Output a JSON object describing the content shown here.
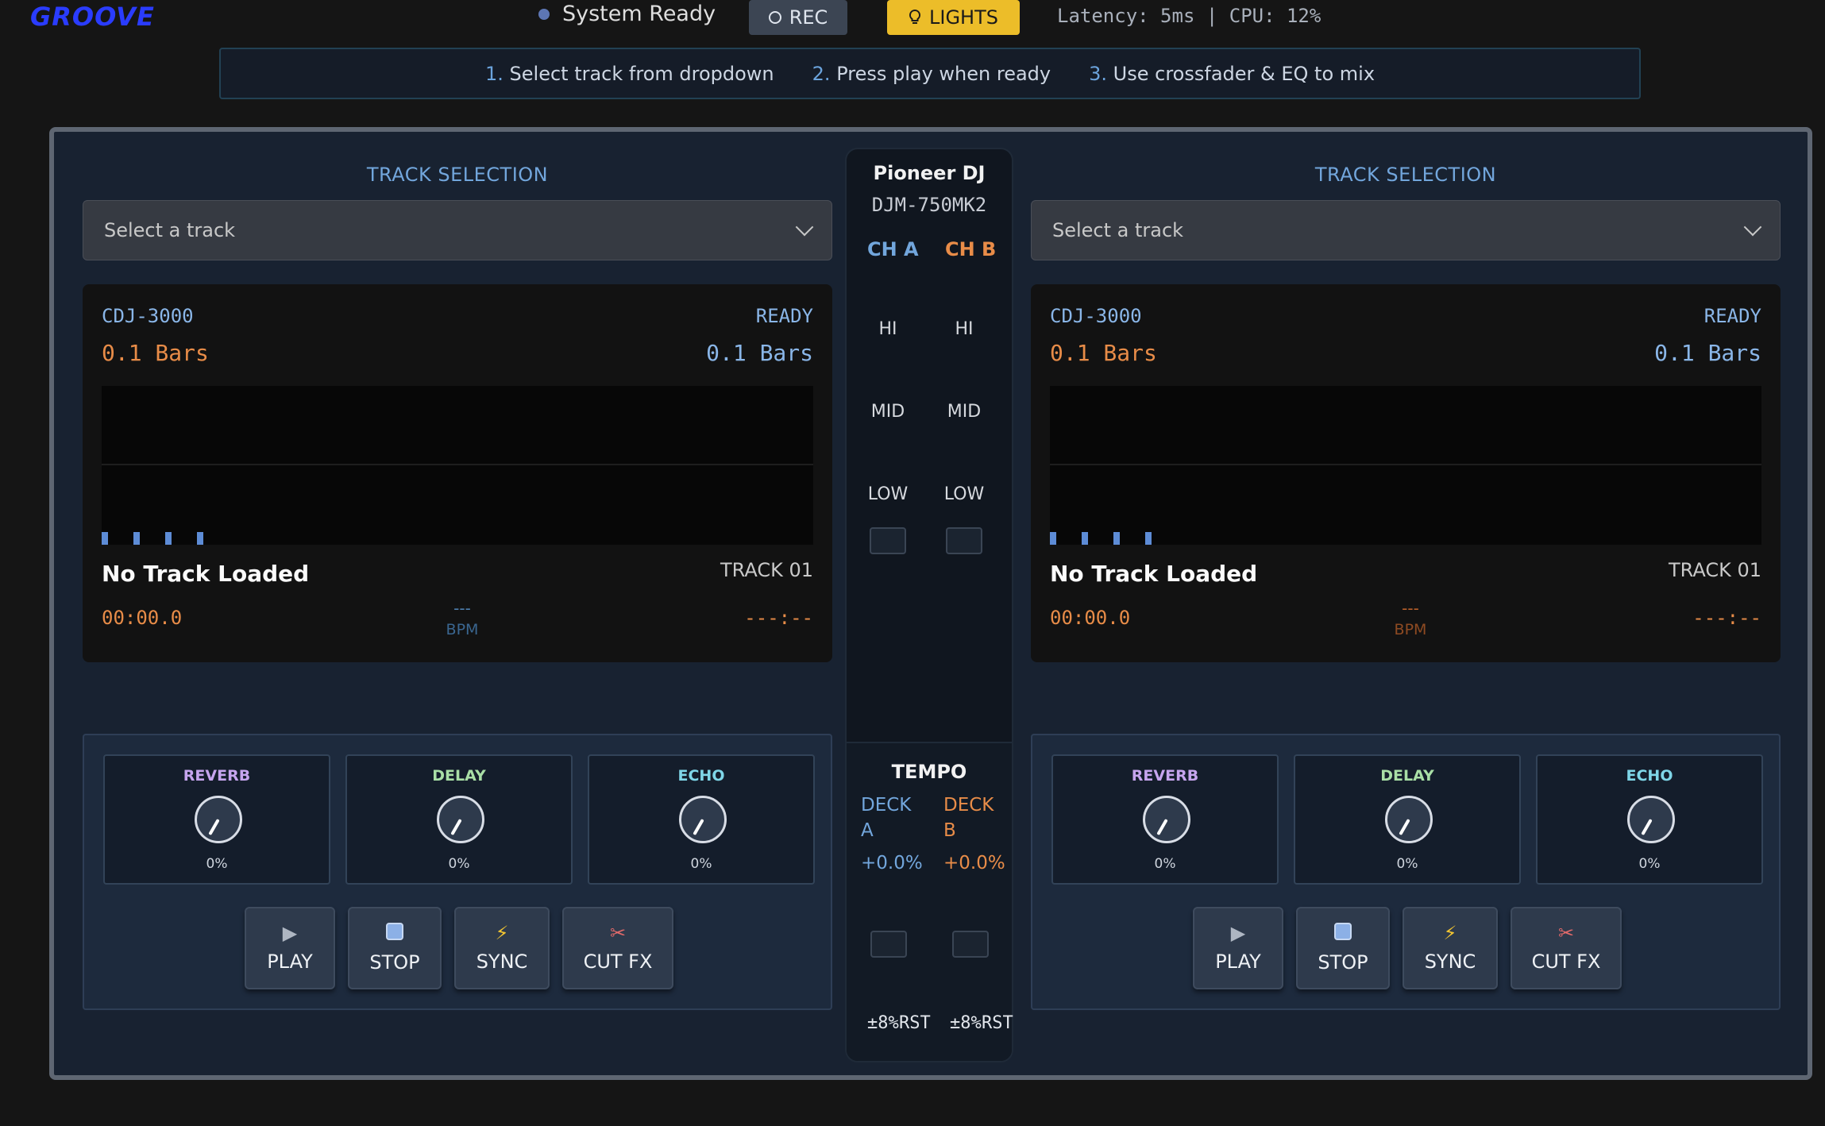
{
  "app": {
    "logo": "GROOVE",
    "status": "System Ready",
    "rec_label": "REC",
    "lights_label": "LIGHTS",
    "latency": "Latency: 5ms | CPU: 12%"
  },
  "instructions": [
    {
      "num": "1.",
      "text": "Select track from dropdown"
    },
    {
      "num": "2.",
      "text": "Press play when ready"
    },
    {
      "num": "3.",
      "text": "Use crossfader & EQ to mix"
    }
  ],
  "decks": [
    {
      "section_label": "TRACK SELECTION",
      "select_placeholder": "Select a track",
      "player_model": "CDJ-3000",
      "player_status": "READY",
      "bars_left": "0.1 Bars",
      "bars_right": "0.1 Bars",
      "track_title": "No Track Loaded",
      "track_number": "TRACK 01",
      "elapsed": "00:00.0",
      "bpm_value": "---",
      "bpm_label": "BPM",
      "remaining": "---:--",
      "fx": [
        {
          "label": "REVERB",
          "value": "0%"
        },
        {
          "label": "DELAY",
          "value": "0%"
        },
        {
          "label": "ECHO",
          "value": "0%"
        }
      ],
      "transport": [
        {
          "label": "PLAY",
          "icon": "play-icon"
        },
        {
          "label": "STOP",
          "icon": "stop-icon"
        },
        {
          "label": "SYNC",
          "icon": "lightning-icon"
        },
        {
          "label": "CUT FX",
          "icon": "scissors-icon"
        }
      ]
    },
    {
      "section_label": "TRACK SELECTION",
      "select_placeholder": "Select a track",
      "player_model": "CDJ-3000",
      "player_status": "READY",
      "bars_left": "0.1 Bars",
      "bars_right": "0.1 Bars",
      "track_title": "No Track Loaded",
      "track_number": "TRACK 01",
      "elapsed": "00:00.0",
      "bpm_value": "---",
      "bpm_label": "BPM",
      "remaining": "---:--",
      "fx": [
        {
          "label": "REVERB",
          "value": "0%"
        },
        {
          "label": "DELAY",
          "value": "0%"
        },
        {
          "label": "ECHO",
          "value": "0%"
        }
      ],
      "transport": [
        {
          "label": "PLAY",
          "icon": "play-icon"
        },
        {
          "label": "STOP",
          "icon": "stop-icon"
        },
        {
          "label": "SYNC",
          "icon": "lightning-icon"
        },
        {
          "label": "CUT FX",
          "icon": "scissors-icon"
        }
      ]
    }
  ],
  "mixer": {
    "brand": "Pioneer DJ",
    "model": "DJM-750MK2",
    "ch_a": "CH A",
    "ch_b": "CH B",
    "eq": [
      "HI",
      "MID",
      "LOW"
    ],
    "tempo_title": "TEMPO",
    "deck_a": "DECK A",
    "deck_b": "DECK B",
    "tempo_a": "+0.0%",
    "tempo_b": "+0.0%",
    "range_a": "±8%",
    "range_b": "±8%",
    "reset_label": "RST"
  },
  "colors": {
    "accent_blue": "#72a6dc",
    "accent_orange": "#e88c48",
    "lights_yellow": "#ecbd29",
    "reverb": "#c6a5ee",
    "delay": "#a9dfa6",
    "echo": "#7fd6e8"
  }
}
